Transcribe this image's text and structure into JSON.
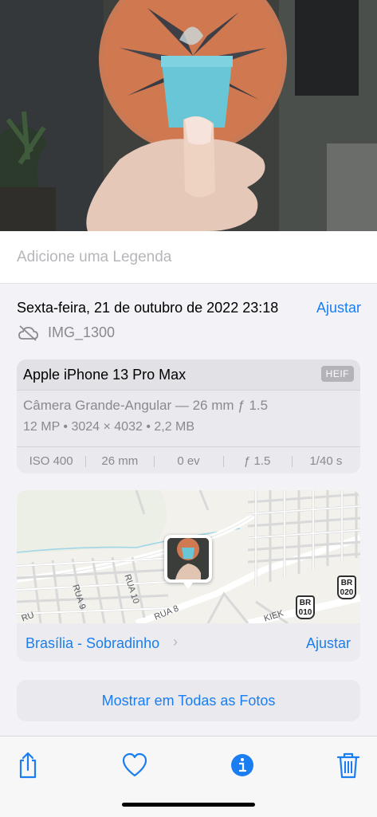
{
  "caption": {
    "placeholder": "Adicione uma Legenda"
  },
  "info": {
    "date": "Sexta-feira, 21 de outubro de 2022 23:18",
    "adjust_label": "Ajustar",
    "file_name": "IMG_1300",
    "cloud_icon": "cloud-slash-icon"
  },
  "device": {
    "name": "Apple iPhone 13 Pro Max",
    "format_badge": "HEIF",
    "lens": "Câmera Grande-Angular — 26 mm ƒ 1.5",
    "specs": "12 MP  •  3024 × 4032  •  2,2 MB",
    "exif": [
      "ISO 400",
      "26 mm",
      "0 ev",
      "ƒ 1.5",
      "1/40 s"
    ]
  },
  "map": {
    "labels": {
      "rua9": "RUA 9",
      "rua10": "RUA 10",
      "rua8": "RUA 8",
      "ruaEdge": "RU",
      "kiek": "KIEK"
    },
    "shields": [
      {
        "top": "BR",
        "bottom": "020"
      },
      {
        "top": "BR",
        "bottom": "010"
      }
    ],
    "place": "Brasília - Sobradinho",
    "adjust_label": "Ajustar"
  },
  "show_all_label": "Mostrar em Todas as Fotos",
  "toolbar": {
    "icons": [
      "share-icon",
      "heart-icon",
      "info-icon",
      "trash-icon"
    ]
  },
  "colors": {
    "accent": "#1a7ef2",
    "secondary_text": "#8a8a8e",
    "background": "#f2f2f7"
  }
}
